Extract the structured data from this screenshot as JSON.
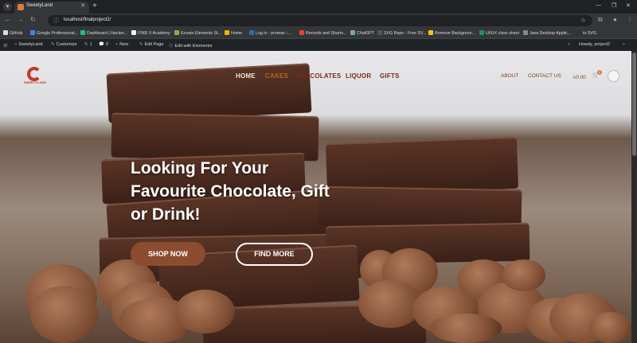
{
  "browser": {
    "tab_title": "SweetyLand",
    "url": "localhost/finalproject2/",
    "bookmarks": [
      "GitHub",
      "Google Professional...",
      "Dashboard | Hacker...",
      "FIND X Academy",
      "Envato Elements St...",
      "Home",
      "Log in - promax -...",
      "Records and Sharin...",
      "ChatGPT",
      "SVG Repo - Free SV...",
      "Remove Backgroun...",
      "UI/UX class sheet",
      "Java Desktop Applic...",
      "to SVG"
    ]
  },
  "wp_admin_bar": {
    "site": "SweetyLand",
    "customize": "Customize",
    "updates": "1",
    "comments": "0",
    "new": "New",
    "edit_page": "Edit Page",
    "elementor": "Edit with Elementor",
    "howdy": "Howdy, project2"
  },
  "site": {
    "logo_text": "SWEETYLAND",
    "nav": [
      "HOME",
      "CAKES",
      "CHOCOLATES",
      "LIQUOR",
      "GIFTS"
    ],
    "nav_right": [
      "ABOUT",
      "CONTACT US"
    ],
    "cart_total": "৳0.00",
    "cart_count": "0"
  },
  "hero": {
    "headline": "Looking For Your Favourite Chocolate, Gift or Drink!",
    "shop_button": "SHOP NOW",
    "find_button": "FIND MORE"
  }
}
